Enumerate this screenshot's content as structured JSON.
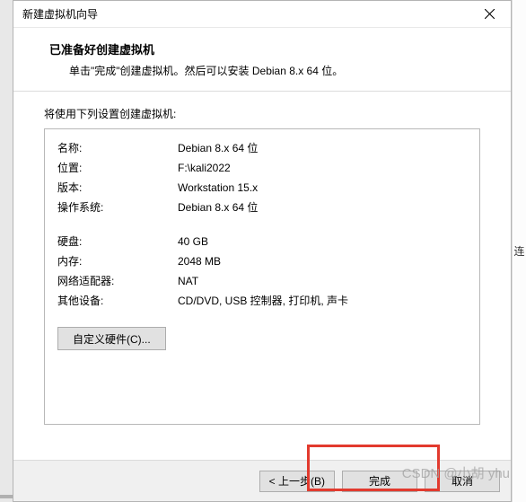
{
  "window": {
    "title": "新建虚拟机向导"
  },
  "header": {
    "title": "已准备好创建虚拟机",
    "subtitle": "单击\"完成\"创建虚拟机。然后可以安装 Debian 8.x 64 位。"
  },
  "content": {
    "label": "将使用下列设置创建虚拟机:",
    "rows_group1": [
      {
        "label": "名称:",
        "value": "Debian 8.x 64 位"
      },
      {
        "label": "位置:",
        "value": "F:\\kali2022"
      },
      {
        "label": "版本:",
        "value": "Workstation 15.x"
      },
      {
        "label": "操作系统:",
        "value": "Debian 8.x 64 位"
      }
    ],
    "rows_group2": [
      {
        "label": "硬盘:",
        "value": "40 GB"
      },
      {
        "label": "内存:",
        "value": "2048 MB"
      },
      {
        "label": "网络适配器:",
        "value": "NAT"
      },
      {
        "label": "其他设备:",
        "value": "CD/DVD, USB 控制器, 打印机, 声卡"
      }
    ],
    "customize_button": "自定义硬件(C)..."
  },
  "footer": {
    "back": "< 上一步(B)",
    "finish": "完成",
    "cancel": "取消"
  },
  "bg_right_char": "连",
  "watermark": "CSDN @小胡 yhu"
}
